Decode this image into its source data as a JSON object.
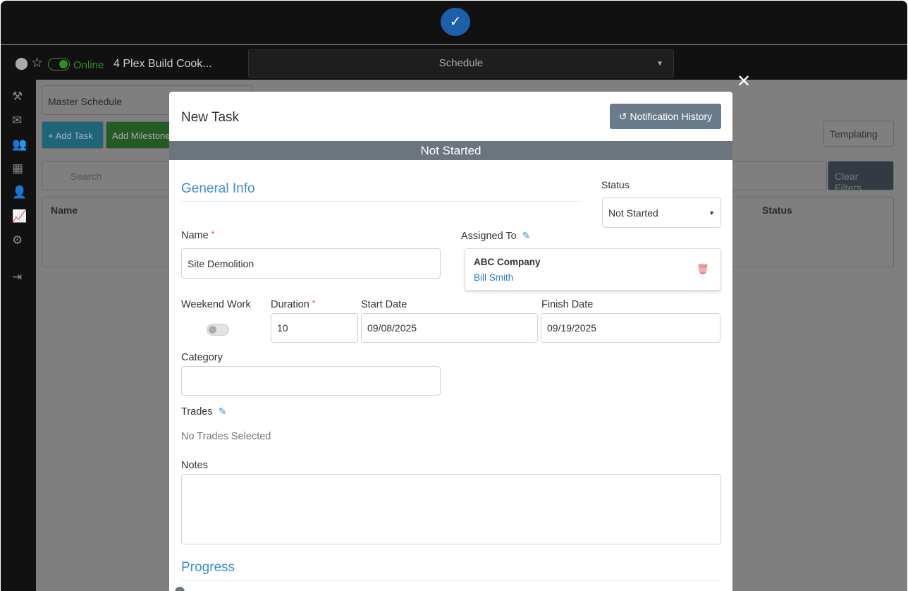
{
  "header": {
    "project": "4 Plex Build Cook...",
    "online_label": "Online",
    "module": "Schedule"
  },
  "background": {
    "schedule_select": "Master Schedule",
    "add_task": "+ Add Task",
    "add_milestone": "Add Milestone",
    "search_placeholder": "Search",
    "templating": "Templating",
    "clear_filters": "Clear Filters",
    "col_name": "Name",
    "col_status": "Status"
  },
  "modal": {
    "title": "New Task",
    "notification_history": "Notification History",
    "status_banner": "Not Started",
    "general_info": "General Info",
    "status_label": "Status",
    "status_value": "Not Started",
    "name_label": "Name",
    "name_value": "Site Demolition",
    "assigned_label": "Assigned To",
    "assigned_company": "ABC Company",
    "assigned_person": "Bill Smith",
    "weekend_label": "Weekend Work",
    "weekend_on": false,
    "duration_label": "Duration",
    "duration_value": "10",
    "start_label": "Start Date",
    "start_value": "09/08/2025",
    "finish_label": "Finish Date",
    "finish_value": "09/19/2025",
    "category_label": "Category",
    "category_value": "",
    "trades_label": "Trades",
    "trades_empty": "No Trades Selected",
    "notes_label": "Notes",
    "notes_value": "",
    "progress_label": "Progress"
  }
}
